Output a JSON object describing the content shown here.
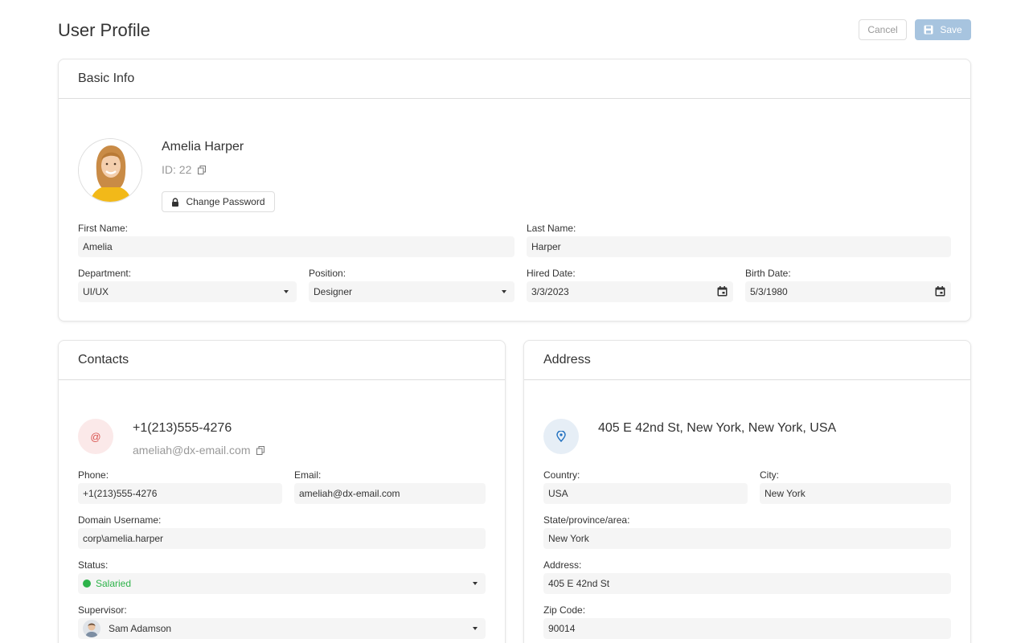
{
  "header": {
    "title": "User Profile",
    "cancel_label": "Cancel",
    "save_label": "Save"
  },
  "basic_info": {
    "title": "Basic Info",
    "name": "Amelia Harper",
    "id_text": "ID: 22",
    "change_password_label": "Change Password",
    "first_name_label": "First Name:",
    "first_name": "Amelia",
    "last_name_label": "Last Name:",
    "last_name": "Harper",
    "department_label": "Department:",
    "department": "UI/UX",
    "position_label": "Position:",
    "position": "Designer",
    "hired_label": "Hired Date:",
    "hired": "3/3/2023",
    "birth_label": "Birth Date:",
    "birth": "5/3/1980"
  },
  "contacts": {
    "title": "Contacts",
    "icon_glyph": "@",
    "primary_phone": "+1(213)555-4276",
    "primary_email": "ameliah@dx-email.com",
    "phone_label": "Phone:",
    "phone": "+1(213)555-4276",
    "email_label": "Email:",
    "email": "ameliah@dx-email.com",
    "domain_label": "Domain Username:",
    "domain": "corp\\amelia.harper",
    "status_label": "Status:",
    "status": "Salaried",
    "supervisor_label": "Supervisor:",
    "supervisor": "Sam Adamson"
  },
  "address": {
    "title": "Address",
    "full_address": "405 E 42nd St, New York, New York, USA",
    "country_label": "Country:",
    "country": "USA",
    "city_label": "City:",
    "city": "New York",
    "state_label": "State/province/area:",
    "state": "New York",
    "address_label": "Address:",
    "address": "405 E 42nd St",
    "zip_label": "Zip Code:",
    "zip": "90014"
  },
  "colors": {
    "accent": "#1f6fbf",
    "save_button": "#a7c4df",
    "status_green": "#2eb34a",
    "contact_icon_bg": "#fbe9e9",
    "contact_icon_fg": "#d9534f",
    "address_icon_bg": "#e6eef6"
  },
  "icons": {
    "save": "floppy-disk-icon",
    "copy": "copy-icon",
    "lock": "lock-icon",
    "contact": "at-sign-icon",
    "address": "map-pin-icon",
    "dropdown": "chevron-down-icon",
    "calendar": "calendar-icon"
  }
}
